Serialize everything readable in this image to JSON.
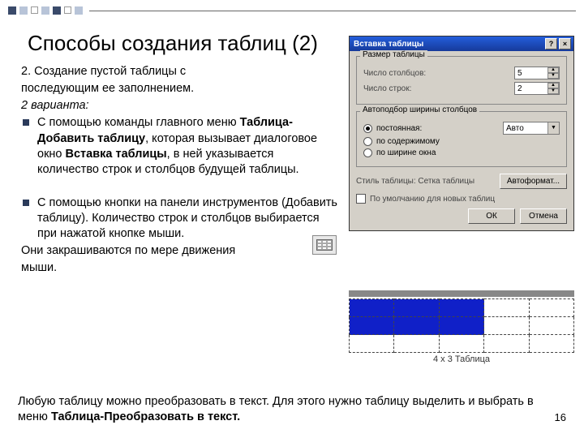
{
  "heading": "Способы создания таблиц (2)",
  "p1_lead": "2. Создание пустой таблицы с",
  "p1_rest": "последующим ее заполнением.",
  "variants": "2 варианта:",
  "b1_a": "С помощью команды главного меню ",
  "b1_bold1": "Таблица-Добавить таблицу",
  "b1_mid": ", которая вызывает диалоговое окно ",
  "b1_bold2": "Вставка таблицы",
  "b1_end": ", в ней указывается количество строк и столбцов будущей таблицы.",
  "b2_a": "С помощью кнопки на панели инструментов (Добавить таблицу). Количество строк и столбцов выбирается при нажатой кнопке мыши.",
  "b2_b": "Они закрашиваются по мере движения",
  "b2_c": "мыши.",
  "footer_text_a": "Любую таблицу можно преобразовать в текст. Для этого нужно таблицу выделить и выбрать в меню ",
  "footer_bold": "Таблица-Преобразовать в текст.",
  "page": "16",
  "dialog": {
    "title": "Вставка таблицы",
    "help": "?",
    "close": "×",
    "group1": "Размер таблицы",
    "cols_label": "Число столбцов:",
    "cols_val": "5",
    "rows_label": "Число строк:",
    "rows_val": "2",
    "group2": "Автоподбор ширины столбцов",
    "r1": "постоянная:",
    "r2": "по содержимому",
    "r3": "по ширине окна",
    "auto": "Авто",
    "style_label": "Стиль таблицы: Сетка таблицы",
    "autofmt": "Автоформат...",
    "remember": "По умолчанию для новых таблиц",
    "ok": "ОК",
    "cancel": "Отмена"
  },
  "grid_label": "4 x 3 Таблица"
}
